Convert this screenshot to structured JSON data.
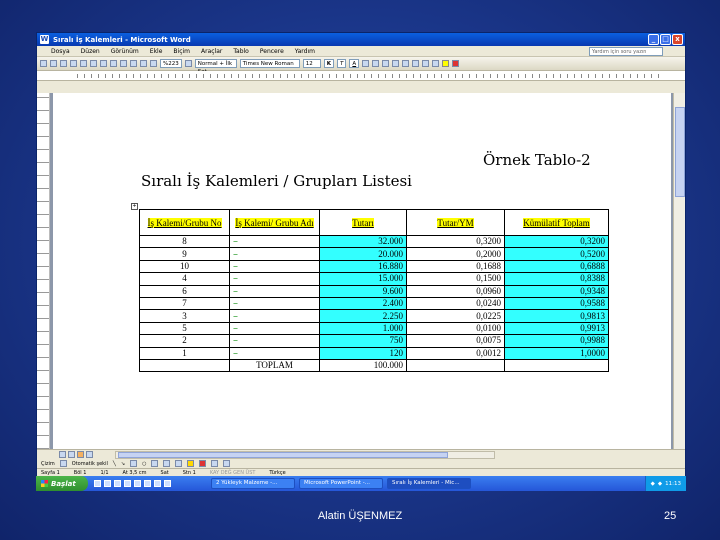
{
  "window": {
    "title": "Sıralı İş Kalemleri - Microsoft Word",
    "minimize": "_",
    "maximize": "□",
    "close": "x"
  },
  "menu": {
    "items": [
      "Dosya",
      "Düzen",
      "Görünüm",
      "Ekle",
      "Biçim",
      "Araçlar",
      "Tablo",
      "Pencere",
      "Yardım"
    ],
    "help_placeholder": "Yardım için soru yazın"
  },
  "toolbar": {
    "zoom": "%223",
    "style": "Normal + İlk Sat",
    "font": "Times New Roman",
    "size": "12",
    "bold": "K",
    "italic": "T",
    "underline": "A"
  },
  "document": {
    "heading": "Sıralı İş Kalemleri / Grupları Listesi",
    "subheading": "Örnek Tablo-2",
    "table": {
      "headers": [
        "İş Kalemi/Grubu No",
        "İş Kalemi/ Grubu Adı",
        "Tutarı",
        "Tutar/YM",
        "Kümülatif Toplam"
      ],
      "rows": [
        {
          "no": "8",
          "name": "........",
          "amount": "32.000",
          "ratio": "0,3200",
          "cum": "0,3200"
        },
        {
          "no": "9",
          "name": "........",
          "amount": "20.000",
          "ratio": "0,2000",
          "cum": "0,5200"
        },
        {
          "no": "10",
          "name": "........",
          "amount": "16.880",
          "ratio": "0,1688",
          "cum": "0,6888"
        },
        {
          "no": "4",
          "name": "........",
          "amount": "15.000",
          "ratio": "0,1500",
          "cum": "0,8388"
        },
        {
          "no": "6",
          "name": "........",
          "amount": "9.600",
          "ratio": "0,0960",
          "cum": "0,9348"
        },
        {
          "no": "7",
          "name": "........",
          "amount": "2.400",
          "ratio": "0,0240",
          "cum": "0,9588"
        },
        {
          "no": "3",
          "name": "........",
          "amount": "2.250",
          "ratio": "0,0225",
          "cum": "0,9813"
        },
        {
          "no": "5",
          "name": "........",
          "amount": "1.000",
          "ratio": "0,0100",
          "cum": "0,9913"
        },
        {
          "no": "2",
          "name": "........",
          "amount": "750",
          "ratio": "0,0075",
          "cum": "0,9988"
        },
        {
          "no": "1",
          "name": "........",
          "amount": "120",
          "ratio": "0,0012",
          "cum": "1,0000"
        }
      ],
      "total_label": "TOPLAM",
      "total_amount": "100.000"
    }
  },
  "drawbar": {
    "label": "Çizim",
    "autoshapes": "Otomatik şekil"
  },
  "status": {
    "page": "Sayfa 1",
    "section": "Böl 1",
    "pages": "1/1",
    "at": "At 3,5 cm",
    "line": "Sat",
    "col": "Stn 1",
    "modes": "KAY DEĞ GEN ÜST",
    "lang": "Türkçe"
  },
  "taskbar": {
    "start": "Başlat",
    "tasks": [
      "2 Yükleyk Malzeme -...",
      "Microsoft PowerPoint -...",
      "Sıralı İş Kalemleri - Mic..."
    ],
    "clock": "11:13"
  },
  "footer": {
    "author": "Alatin ÜŞENMEZ",
    "page": "25"
  },
  "colors": {
    "highlight_yellow": "#ffff00",
    "highlight_cyan": "#33ffff",
    "slide_bg": "#1a3588"
  }
}
